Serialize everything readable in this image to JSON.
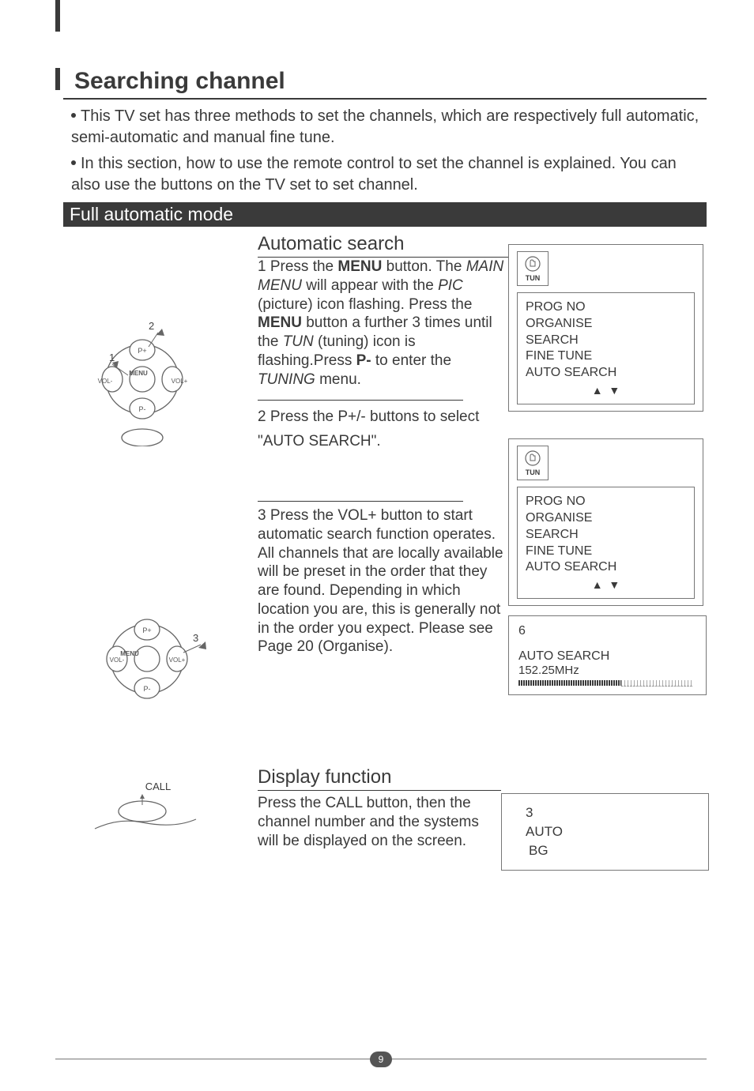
{
  "title": "Searching channel",
  "intro1": "This TV set has three methods to set the channels, which are respectively full automatic, semi-automatic and manual fine tune.",
  "intro2": "In this section, how to use the remote control to set the channel is explained. You can also use the buttons on the TV set to set channel.",
  "band": "Full automatic mode",
  "sec1": "Automatic search",
  "step1a": "1 Press the ",
  "step1b": " button. The ",
  "step1c": " will appear with the ",
  "step1d": " (picture) icon flashing. Press the ",
  "step1e": " button a further 3 times until the ",
  "step1f": " (tuning) icon is flashing.Press ",
  "step1g": " to enter the ",
  "step1h": " menu.",
  "menu_bold": "MENU",
  "mainmenu": "MAIN MENU",
  "pic": "PIC",
  "tun": "TUN",
  "pminus": "P-",
  "tuning": "TUNING",
  "step2": "2 Press the P+/- buttons  to select  \"AUTO SEARCH\".",
  "step3": "3 Press the VOL+ button to start automatic search function operates. All channels that are locally available will be preset in the order that they are found. Depending in which location you are, this is generally not in the order you expect. Please see Page 20 (Organise).",
  "osd": {
    "tun": "TUN",
    "items": [
      "PROG NO",
      "ORGANISE",
      "SEARCH",
      "FINE TUNE",
      "AUTO SEARCH"
    ]
  },
  "progress": {
    "ch": "6",
    "label": "AUTO SEARCH",
    "freq": "152.25MHz"
  },
  "sec2": "Display function",
  "disp_text": "Press the CALL button, then the channel number and  the systems  will be displayed on the screen.",
  "disp_osd": {
    "ch": "3",
    "mode": "AUTO",
    "sys": "BG"
  },
  "remote": {
    "p_plus": "P+",
    "p_minus": "P-",
    "menu": "MENU",
    "vol_plus": "VOL+",
    "vol_minus": "VOL-",
    "call": "CALL",
    "n1": "1",
    "n2": "2",
    "n3": "3"
  },
  "page_num": "9"
}
